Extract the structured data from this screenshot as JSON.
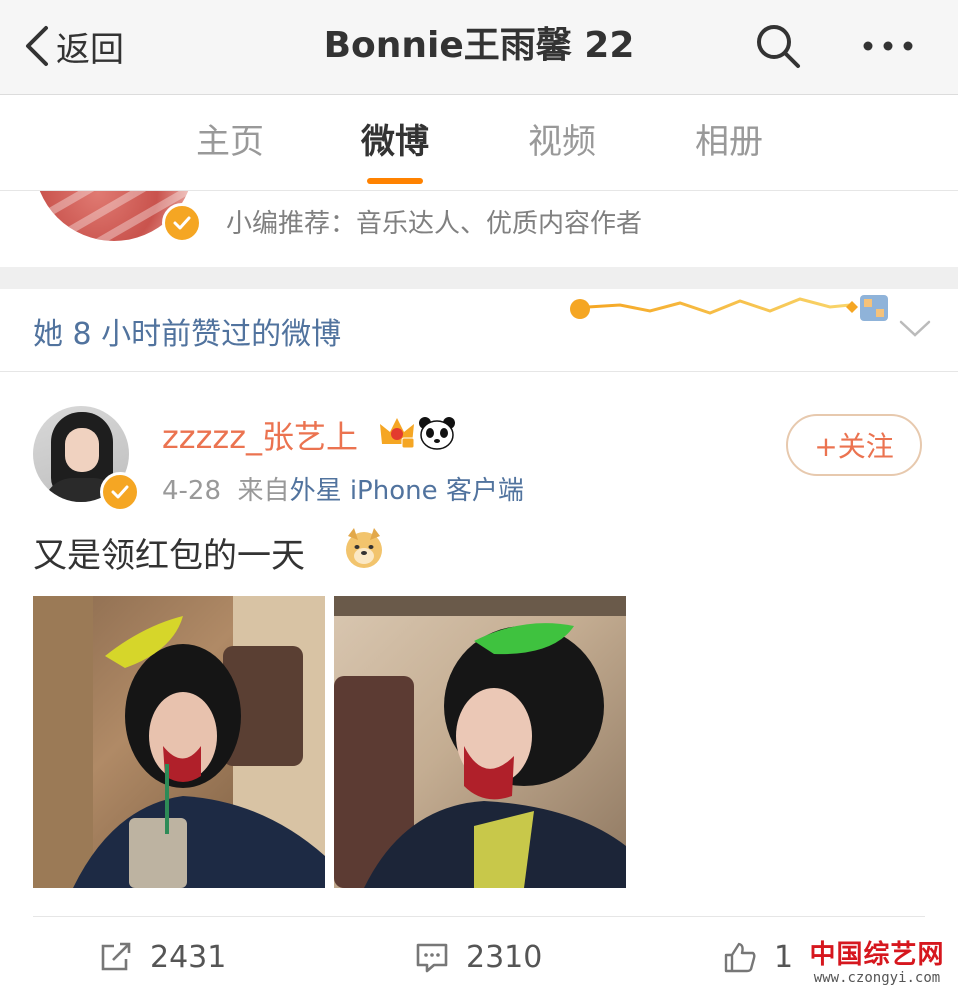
{
  "navbar": {
    "back_label": "返回",
    "title": "Bonnie王雨馨 22"
  },
  "tabs": [
    {
      "label": "主页",
      "active": false
    },
    {
      "label": "微博",
      "active": true
    },
    {
      "label": "视频",
      "active": false
    },
    {
      "label": "相册",
      "active": false
    }
  ],
  "profile": {
    "recommend_text": "小编推荐：音乐达人、优质内容作者"
  },
  "liked_section": {
    "title": "她 8 小时前赞过的微博"
  },
  "post": {
    "author": "zzzzz_张艺上",
    "date": "4-28",
    "source_prefix": "来自",
    "source": "外星 iPhone 客户端",
    "follow_label": "+关注",
    "text": "又是领红包的一天",
    "icons": [
      "vip-crown-icon",
      "panda-icon",
      "doge-icon"
    ],
    "images": [
      "post-image-1",
      "post-image-2"
    ],
    "actions": {
      "repost_count": "2431",
      "comment_count": "2310",
      "like_count": "1"
    }
  },
  "watermark": {
    "title": "中国综艺网",
    "url": "www.czongyi.com"
  },
  "colors": {
    "accent_orange": "#ff8200",
    "author_orange": "#eb7350",
    "link_blue": "#51739e",
    "verified_gold": "#f5a623"
  }
}
